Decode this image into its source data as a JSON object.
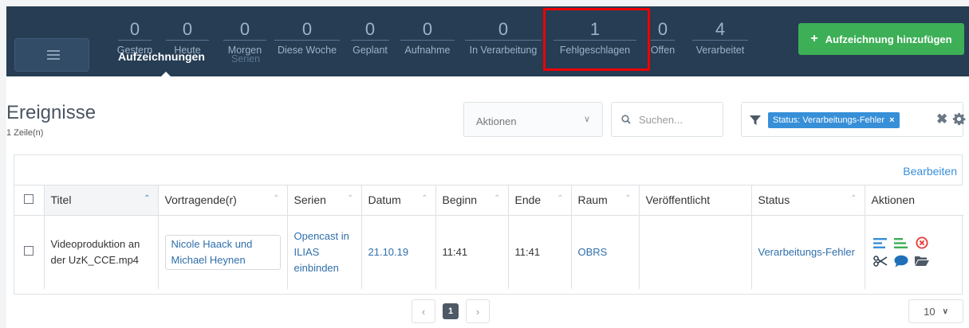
{
  "header": {
    "stats": [
      {
        "value": "0",
        "label": "Gestern"
      },
      {
        "value": "0",
        "label": "Heute"
      },
      {
        "value": "0",
        "label": "Morgen"
      },
      {
        "value": "0",
        "label": "Diese Woche"
      },
      {
        "value": "0",
        "label": "Geplant"
      },
      {
        "value": "0",
        "label": "Aufnahme"
      },
      {
        "value": "0",
        "label": "In Verarbeitung"
      },
      {
        "value": "1",
        "label": "Fehlgeschlagen"
      },
      {
        "value": "0",
        "label": "Offen"
      },
      {
        "value": "4",
        "label": "Verarbeitet"
      }
    ],
    "tab_recordings": "Aufzeichnungen",
    "tab_series": "Serien",
    "add_button_label": "Aufzeichnung hinzufügen",
    "highlight_color": "#e00000"
  },
  "events": {
    "title": "Ereignisse",
    "row_count": "1 Zeile(n)",
    "actions_placeholder": "Aktionen",
    "search_placeholder": "Suchen...",
    "filter_tag": "Status: Verarbeitungs-Fehler",
    "edit_label": "Bearbeiten"
  },
  "table": {
    "columns": [
      "Titel",
      "Vortragende(r)",
      "Serien",
      "Datum",
      "Beginn",
      "Ende",
      "Raum",
      "Veröffentlicht",
      "Status",
      "Aktionen"
    ],
    "rows": [
      {
        "title": "Videoproduktion an der UzK_CCE.mp4",
        "presenters": "Nicole Haack und Michael Heynen",
        "series": "Opencast in ILIAS einbinden",
        "date": "21.10.19",
        "start": "11:41",
        "end": "11:41",
        "room": "OBRS",
        "published": "",
        "status": "Verarbeitungs-Fehler"
      }
    ]
  },
  "pagination": {
    "current_page": "1",
    "page_size": "10"
  },
  "colors": {
    "header_bg": "#263d54",
    "accent": "#378fd8",
    "add_button": "#3daf56",
    "delete": "#e53935"
  }
}
